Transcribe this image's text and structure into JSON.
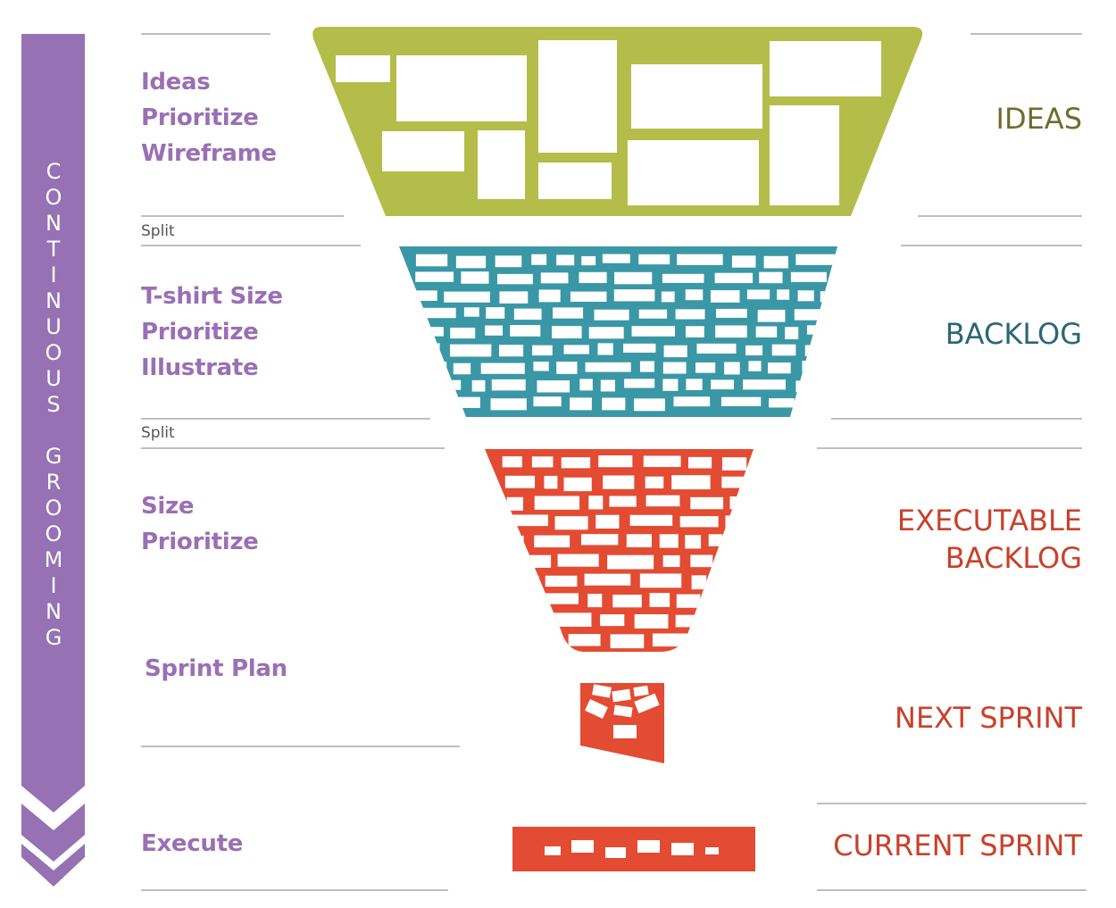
{
  "side_banner": {
    "text": "CONTINUOUS GROOMING",
    "color": "#9671b4",
    "icon": "chevron-down-arrow"
  },
  "stages": [
    {
      "activities": [
        "Ideas",
        "Prioritize",
        "Wireframe"
      ],
      "label": [
        "IDEAS"
      ],
      "color": "#b5bd4a",
      "label_color": "#6b6e2c"
    },
    {
      "activities": [
        "T-shirt Size",
        "Prioritize",
        "Illustrate"
      ],
      "label": [
        "BACKLOG"
      ],
      "color": "#3a97a6",
      "label_color": "#2b6676"
    },
    {
      "activities": [
        "Size",
        "Prioritize"
      ],
      "label": [
        "EXECUTABLE",
        "BACKLOG"
      ],
      "color": "#e34b32",
      "label_color": "#c9412b"
    },
    {
      "activities": [
        "Sprint Plan"
      ],
      "label": [
        "NEXT SPRINT"
      ],
      "color": "#e34b32",
      "label_color": "#c9412b"
    },
    {
      "activities": [
        "Execute"
      ],
      "label": [
        "CURRENT SPRINT"
      ],
      "color": "#e34b32",
      "label_color": "#c9412b"
    }
  ],
  "splits": [
    "Split",
    "Split"
  ]
}
